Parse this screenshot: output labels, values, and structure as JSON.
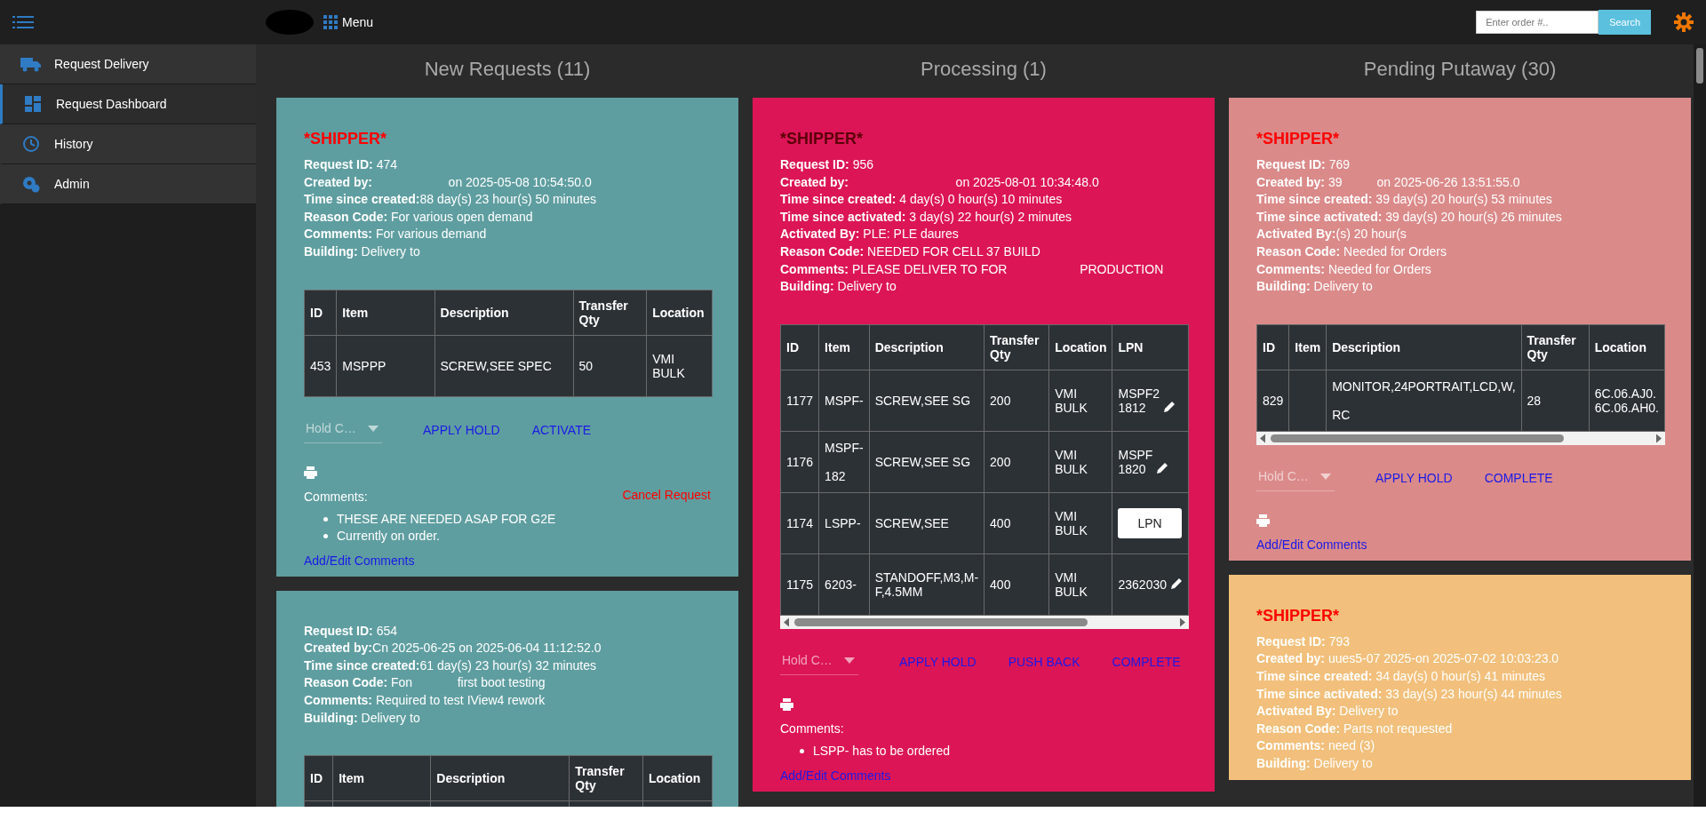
{
  "top_bar": {
    "menu_label": "Menu",
    "search": {
      "placeholder": "Enter order #..",
      "button": "Search"
    }
  },
  "sidebar": {
    "items": [
      {
        "label": "Request Delivery",
        "kind": "truck",
        "selected": false
      },
      {
        "label": "Request Dashboard",
        "kind": "dashboard",
        "selected": true
      },
      {
        "label": "History",
        "kind": "history",
        "selected": false
      },
      {
        "label": "Admin",
        "kind": "admin",
        "selected": false
      }
    ]
  },
  "columns": [
    {
      "title": "New Requests (11)",
      "cards": [
        {
          "color": "#5f9ea0",
          "title": "*SHIPPER*",
          "fields": [
            "**Request ID:** 474",
            "**Created by:**                      on 2025-05-08 10:54:50.0",
            "**Time since created:**88 day(s) 23 hour(s) 50 minutes",
            "**Reason Code:** For various open demand",
            "**Comments:** For various demand",
            "**Building:** Delivery to"
          ],
          "table": {
            "columns": [
              "ID",
              "Item",
              "Description",
              "Transfer Qty",
              "Location"
            ],
            "rows": [
              [
                "453",
                "MSPPP",
                "SCREW,SEE SPEC",
                "50",
                "VMI\nBULK"
              ]
            ]
          },
          "hold": "Hold C…",
          "actions": [
            "APPLY HOLD",
            "ACTIVATE"
          ],
          "cancel": "Cancel Request",
          "comments_label": "Comments:",
          "comments": [
            "THESE ARE NEEDED ASAP FOR G2E",
            "Currently on order."
          ],
          "edit_link": "Add/Edit Comments"
        },
        {
          "color": "#5f9ea0",
          "fields": [
            "**Request ID:** 654",
            "**Created by:**Cn 2025-06-25 on 2025-06-04 11:12:52.0",
            "**Time since created:**61 day(s) 23 hour(s) 32 minutes",
            "**Reason Code:** Fon             first boot testing",
            "**Comments:** Required to test IView4 rework",
            "**Building:** Delivery to"
          ],
          "table": {
            "columns": [
              "ID",
              "Item",
              "Description",
              "Transfer Qty",
              "Location"
            ]
          }
        }
      ]
    },
    {
      "title": "Processing (1)",
      "cards": [
        {
          "color": "#dc1557",
          "title": "*SHIPPER*",
          "fields": [
            "**Request ID:** 956",
            "**Created by:**                               on 2025-08-01 10:34:48.0",
            "**Time since created:** 4 day(s) 0 hour(s) 10 minutes",
            "**Time since activated:** 3 day(s) 22 hour(s) 2 minutes",
            "**Activated By:** PLE: PLE daures",
            "**Reason Code:** NEEDED FOR CELL 37 BUILD",
            "**Comments:** PLEASE DELIVER TO FOR                     PRODUCTION",
            "**Building:** Delivery to"
          ],
          "table": {
            "h_scrollbar": true,
            "columns": [
              "ID",
              "Item",
              "Description",
              "Transfer Qty",
              "Location",
              "LPN"
            ],
            "rows": [
              [
                "1177",
                "MSPF-",
                "SCREW,SEE SG",
                "200",
                "VMI\nBULK",
                {
                  "kind": "edit",
                  "text": "MSPF2\n1812"
                }
              ],
              [
                "1176",
                "MSPF-\n\n182",
                "SCREW,SEE SG",
                "200",
                "VMI\nBULK",
                {
                  "kind": "edit",
                  "text": "MSPF\n1820"
                }
              ],
              [
                "1174",
                "LSPP-",
                "SCREW,SEE",
                "400",
                "VMI\nBULK",
                {
                  "kind": "button",
                  "text": "LPN"
                }
              ],
              [
                "1175",
                "6203-",
                "STANDOFF,M3,M-\nF,4.5MM",
                "400",
                "VMI\nBULK",
                {
                  "kind": "edit",
                  "text": "2362030"
                }
              ]
            ]
          },
          "hold": "Hold C…",
          "actions": [
            "APPLY HOLD",
            "PUSH BACK",
            "COMPLETE"
          ],
          "comments_label": "Comments:",
          "comments": [
            "LSPP-                    has to be ordered"
          ],
          "edit_link": "Add/Edit Comments"
        }
      ]
    },
    {
      "title": "Pending Putaway (30)",
      "cards": [
        {
          "color": "#db8a8a",
          "title": "*SHIPPER*",
          "fields": [
            "**Request ID:** 769",
            "**Created by:** 39          on 2025-06-26 13:51:55.0",
            "**Time since created:** 39 day(s) 20 hour(s) 53 minutes",
            "**Time since activated:** 39 day(s) 20 hour(s) 26 minutes",
            "**Activated By:**(s) 20 hour(s",
            "**Reason Code:** Needed for Orders",
            "**Comments:** Needed for Orders",
            "**Building:** Delivery to"
          ],
          "table": {
            "h_scrollbar": true,
            "columns": [
              "ID",
              "Item",
              "Description",
              "Transfer Qty",
              "Location"
            ],
            "rows": [
              [
                "829",
                "",
                "MONITOR,24PORTRAIT,LCD,W,\n\nRC",
                "28",
                "6C.06.AJ0.\n6C.06.AH0."
              ]
            ]
          },
          "hold": "Hold C…",
          "actions": [
            "APPLY HOLD",
            "COMPLETE"
          ],
          "edit_link": "Add/Edit Comments"
        },
        {
          "color": "#f2c07c",
          "title": "*SHIPPER*",
          "fields": [
            "**Request ID:** 793",
            "**Created by:** uues5-07 2025-on 2025-07-02 10:03:23.0",
            "**Time since created:** 34 day(s) 0 hour(s) 41 minutes",
            "**Time since activated:** 33 day(s) 23 hour(s) 44 minutes",
            "**Activated By:** Delivery to",
            "**Reason Code:** Parts not requested",
            "**Comments:** need (3)",
            "**Building:** Delivery to"
          ]
        }
      ]
    }
  ]
}
